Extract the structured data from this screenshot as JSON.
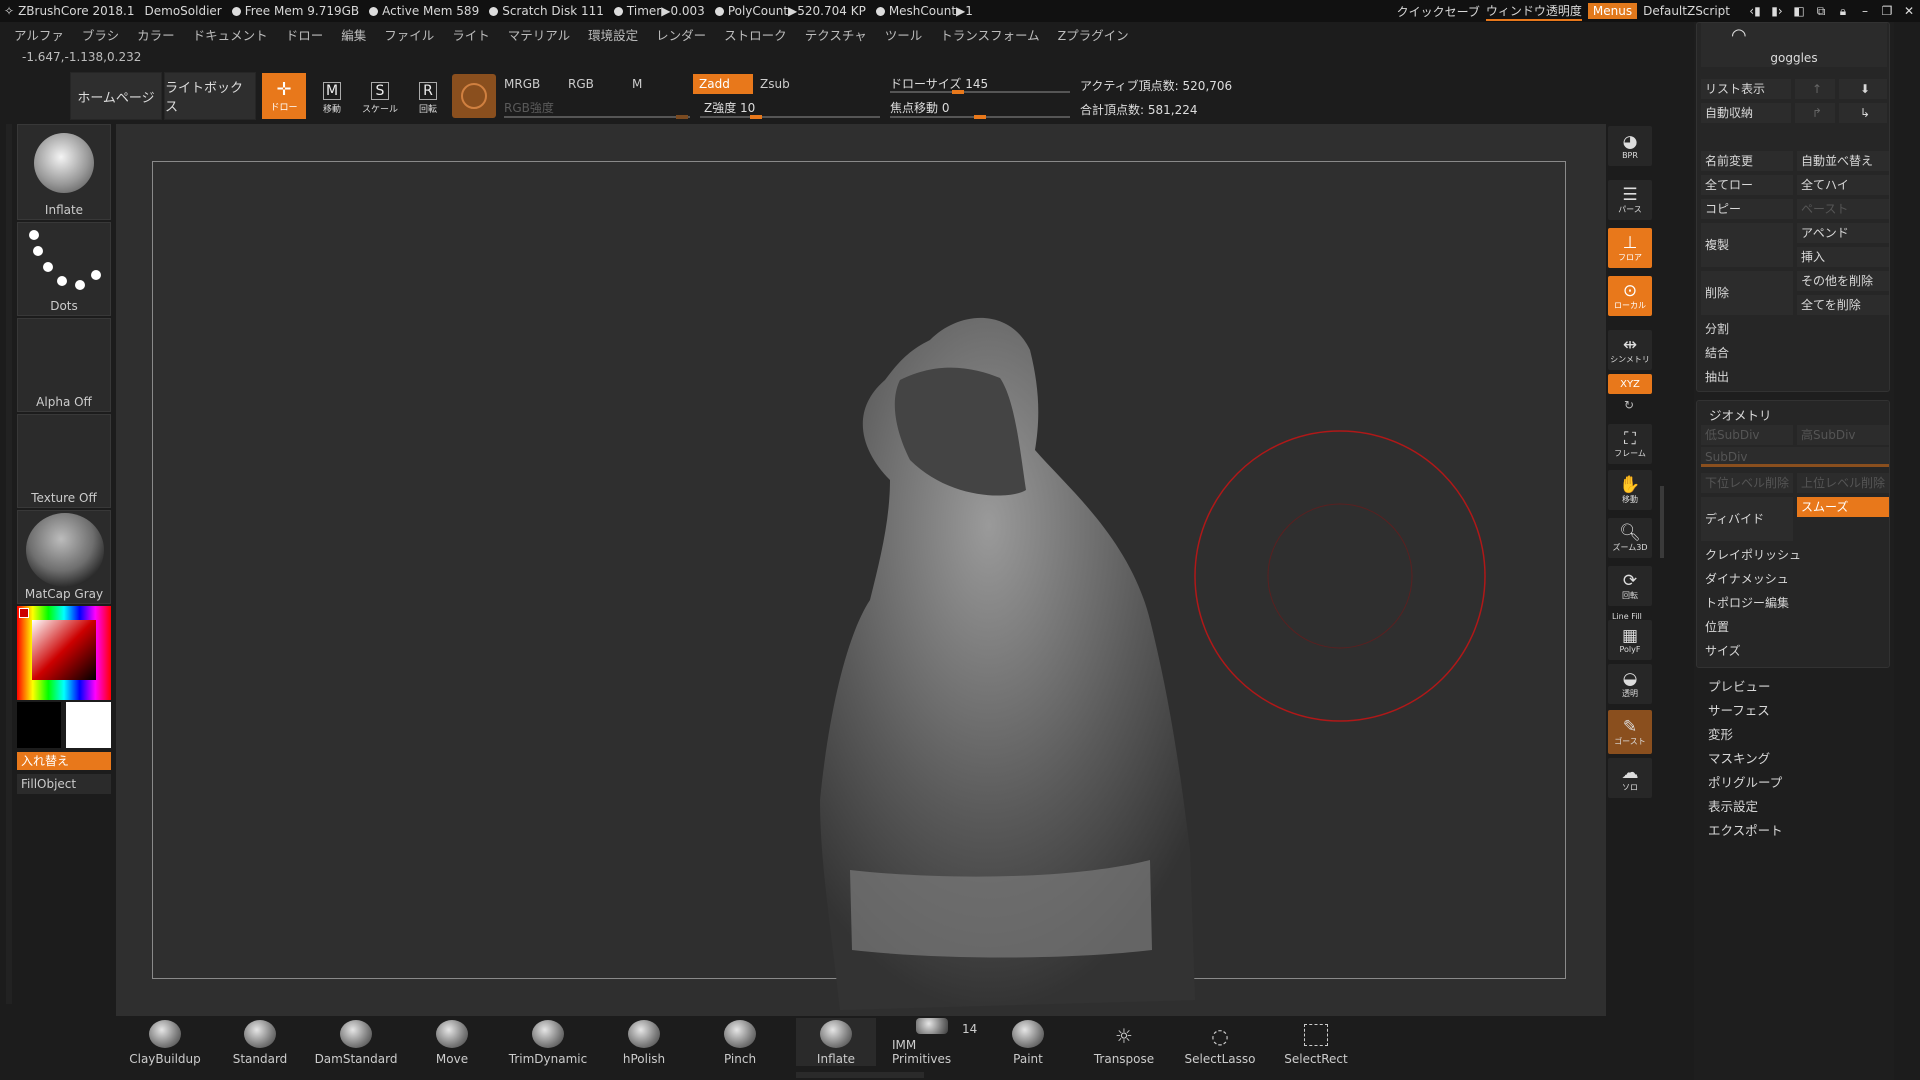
{
  "titlebar": {
    "app": "ZBrushCore 2018.1",
    "project": "DemoSoldier",
    "free_mem": "Free Mem 9.719GB",
    "active_mem": "Active Mem 589",
    "scratch": "Scratch Disk 111",
    "timer": "Timer▶0.003",
    "polycount": "PolyCount▶520.704 KP",
    "meshcount": "MeshCount▶1",
    "quicksave": "クイックセーブ",
    "transparency": "ウィンドウ透明度",
    "menus": "Menus",
    "script": "DefaultZScript"
  },
  "menubar": [
    "アルファ",
    "ブラシ",
    "カラー",
    "ドキュメント",
    "ドロー",
    "編集",
    "ファイル",
    "ライト",
    "マテリアル",
    "環境設定",
    "レンダー",
    "ストローク",
    "テクスチャ",
    "ツール",
    "トランスフォーム",
    "Zプラグイン"
  ],
  "coords": "-1.647,-1.138,0.232",
  "shelf": {
    "home": "ホームページ",
    "lightbox": "ライトボックス",
    "draw": "ドロー",
    "move": "移動",
    "scale": "スケール",
    "rotate": "回転",
    "mrgb": "MRGB",
    "rgb": "RGB",
    "m": "M",
    "zadd": "Zadd",
    "zsub": "Zsub",
    "rgb_intensity": "RGB強度",
    "z_intensity": "Z強度 10",
    "draw_size": "ドローサイズ 145",
    "focal_shift": "焦点移動 0",
    "active_points": "アクティブ頂点数: 520,706",
    "total_points": "合計頂点数: 581,224"
  },
  "left": {
    "brush": "Inflate",
    "stroke": "Dots",
    "alpha": "Alpha Off",
    "texture": "Texture Off",
    "material": "MatCap Gray",
    "swap": "入れ替え",
    "fill": "FillObject"
  },
  "right_tools": [
    {
      "label": "BPR",
      "name": "bpr"
    },
    {
      "label": "パース",
      "name": "perspective"
    },
    {
      "label": "フロア",
      "name": "floor"
    },
    {
      "label": "ローカル",
      "name": "local"
    },
    {
      "label": "シンメトリ",
      "name": "symmetry"
    },
    {
      "label": "XYZ",
      "name": "xyz"
    },
    {
      "label": "フレーム",
      "name": "frame"
    },
    {
      "label": "移動",
      "name": "move-view"
    },
    {
      "label": "ズーム3D",
      "name": "zoom3d"
    },
    {
      "label": "回転",
      "name": "rotate-view"
    },
    {
      "label": "PolyF",
      "name": "polyf"
    },
    {
      "label": "透明",
      "name": "transparent"
    },
    {
      "label": "ゴースト",
      "name": "ghost"
    },
    {
      "label": "ソロ",
      "name": "solo"
    }
  ],
  "right_tool_extra": {
    "linefill": "Line Fill"
  },
  "subtool": {
    "name": "goggles",
    "list": "リスト表示",
    "autocollapse": "自動収納",
    "rename": "名前変更",
    "autoreorder": "自動並べ替え",
    "alllow": "全てロー",
    "allhigh": "全てハイ",
    "copy": "コピー",
    "paste": "ペースト",
    "duplicate": "複製",
    "append": "アペンド",
    "insert": "挿入",
    "delete": "削除",
    "delother": "その他を削除",
    "delall": "全てを削除",
    "split": "分割",
    "merge": "結合",
    "extract": "抽出"
  },
  "geometry": {
    "title": "ジオメトリ",
    "lower": "低SubDiv",
    "higher": "高SubDiv",
    "subdiv": "SubDiv",
    "dellower": "下位レベル削除",
    "delhigher": "上位レベル削除",
    "divide": "ディバイド",
    "smooth": "スムーズ",
    "rows": [
      "クレイポリッシュ",
      "ダイナメッシュ",
      "トポロジー編集",
      "位置",
      "サイズ"
    ]
  },
  "sections": [
    "プレビュー",
    "サーフェス",
    "変形",
    "マスキング",
    "ポリグループ",
    "表示設定",
    "エクスポート"
  ],
  "bottom_brushes": [
    "ClayBuildup",
    "Standard",
    "DamStandard",
    "Move",
    "TrimDynamic",
    "hPolish",
    "Pinch",
    "Inflate",
    "IMM Primitives",
    "Paint",
    "Transpose",
    "SelectLasso",
    "SelectRect"
  ],
  "imm_count": "14",
  "colors": {
    "accent": "#e8781b",
    "cursor": "#b01818"
  }
}
